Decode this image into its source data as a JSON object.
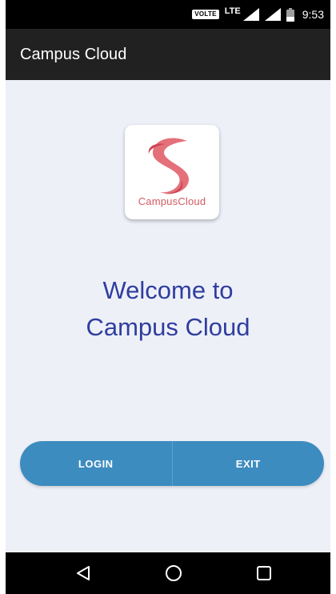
{
  "status_bar": {
    "volte_label": "VOLTE",
    "network_label": "LTE",
    "time": "9:53",
    "icons": [
      "volte-icon",
      "signal-icon",
      "signal-icon",
      "battery-icon"
    ]
  },
  "app_bar": {
    "title": "Campus Cloud"
  },
  "logo": {
    "text": "CampusCloud",
    "color": "#d35a62"
  },
  "welcome": {
    "line1": "Welcome to",
    "line2": "Campus Cloud",
    "color": "#2f3e9e"
  },
  "buttons": {
    "login_label": "LOGIN",
    "exit_label": "EXIT",
    "color": "#3d8cc0"
  },
  "nav_bar": {
    "icons": [
      "back-icon",
      "home-icon",
      "recents-icon"
    ]
  }
}
